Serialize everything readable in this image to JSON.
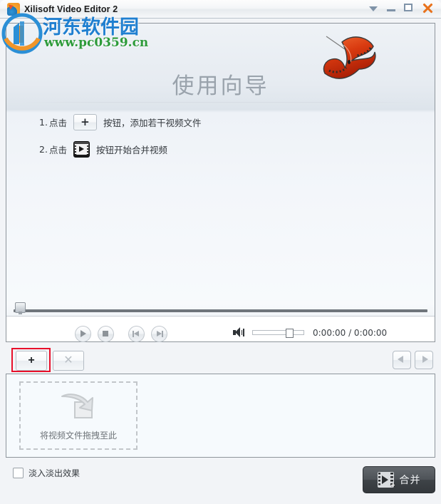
{
  "window": {
    "title": "Xilisoft Video Editor 2",
    "app_icon": "xilisoft-app-icon",
    "controls": {
      "menu": "menu-chevron-icon",
      "minimize": "minimize-icon",
      "maximize": "maximize-icon",
      "close": "close-icon"
    }
  },
  "watermark": {
    "site_name": "河东软件园",
    "url": "www.pc0359.cn",
    "name_color": "#1f7fd0",
    "url_color": "#2e9b3a"
  },
  "preview": {
    "guide_title": "使用向导",
    "steps": [
      {
        "number": "1.",
        "prefix": "点击",
        "icon": "plus-button-icon",
        "icon_glyph": "+",
        "suffix": "按钮，添加若干视频文件"
      },
      {
        "number": "2.",
        "prefix": "点击",
        "icon": "merge-film-icon",
        "suffix": "按钮开始合并视频"
      }
    ],
    "decoration": "xilisoft-film-ribbon-logo",
    "scrubber": {
      "name": "preview-scrubber",
      "position_percent": 0
    }
  },
  "player": {
    "play_button": "play-icon",
    "stop_button": "stop-icon",
    "prev_button": "previous-track-icon",
    "next_button": "next-track-icon",
    "volume_icon": "volume-speaker-icon",
    "volume_percent": 63,
    "time_current": "0:00:00",
    "time_total": "0:00:00",
    "time_display": "0:00:00 / 0:00:00"
  },
  "toolbar": {
    "add_label": "+",
    "add_name": "add-file-button",
    "delete_label": "✕",
    "delete_name": "delete-file-button",
    "prev_label": "previous-page-arrow",
    "next_label": "next-page-arrow",
    "highlight_color": "#e8102a"
  },
  "cliplist": {
    "dropzone_icon": "drag-drop-arrow-icon",
    "dropzone_label": "将视频文件拖拽至此"
  },
  "bottom": {
    "fade_checkbox_label": "淡入淡出效果",
    "fade_checked": false,
    "merge_button_label": "合并",
    "merge_button_icon": "merge-film-icon"
  }
}
